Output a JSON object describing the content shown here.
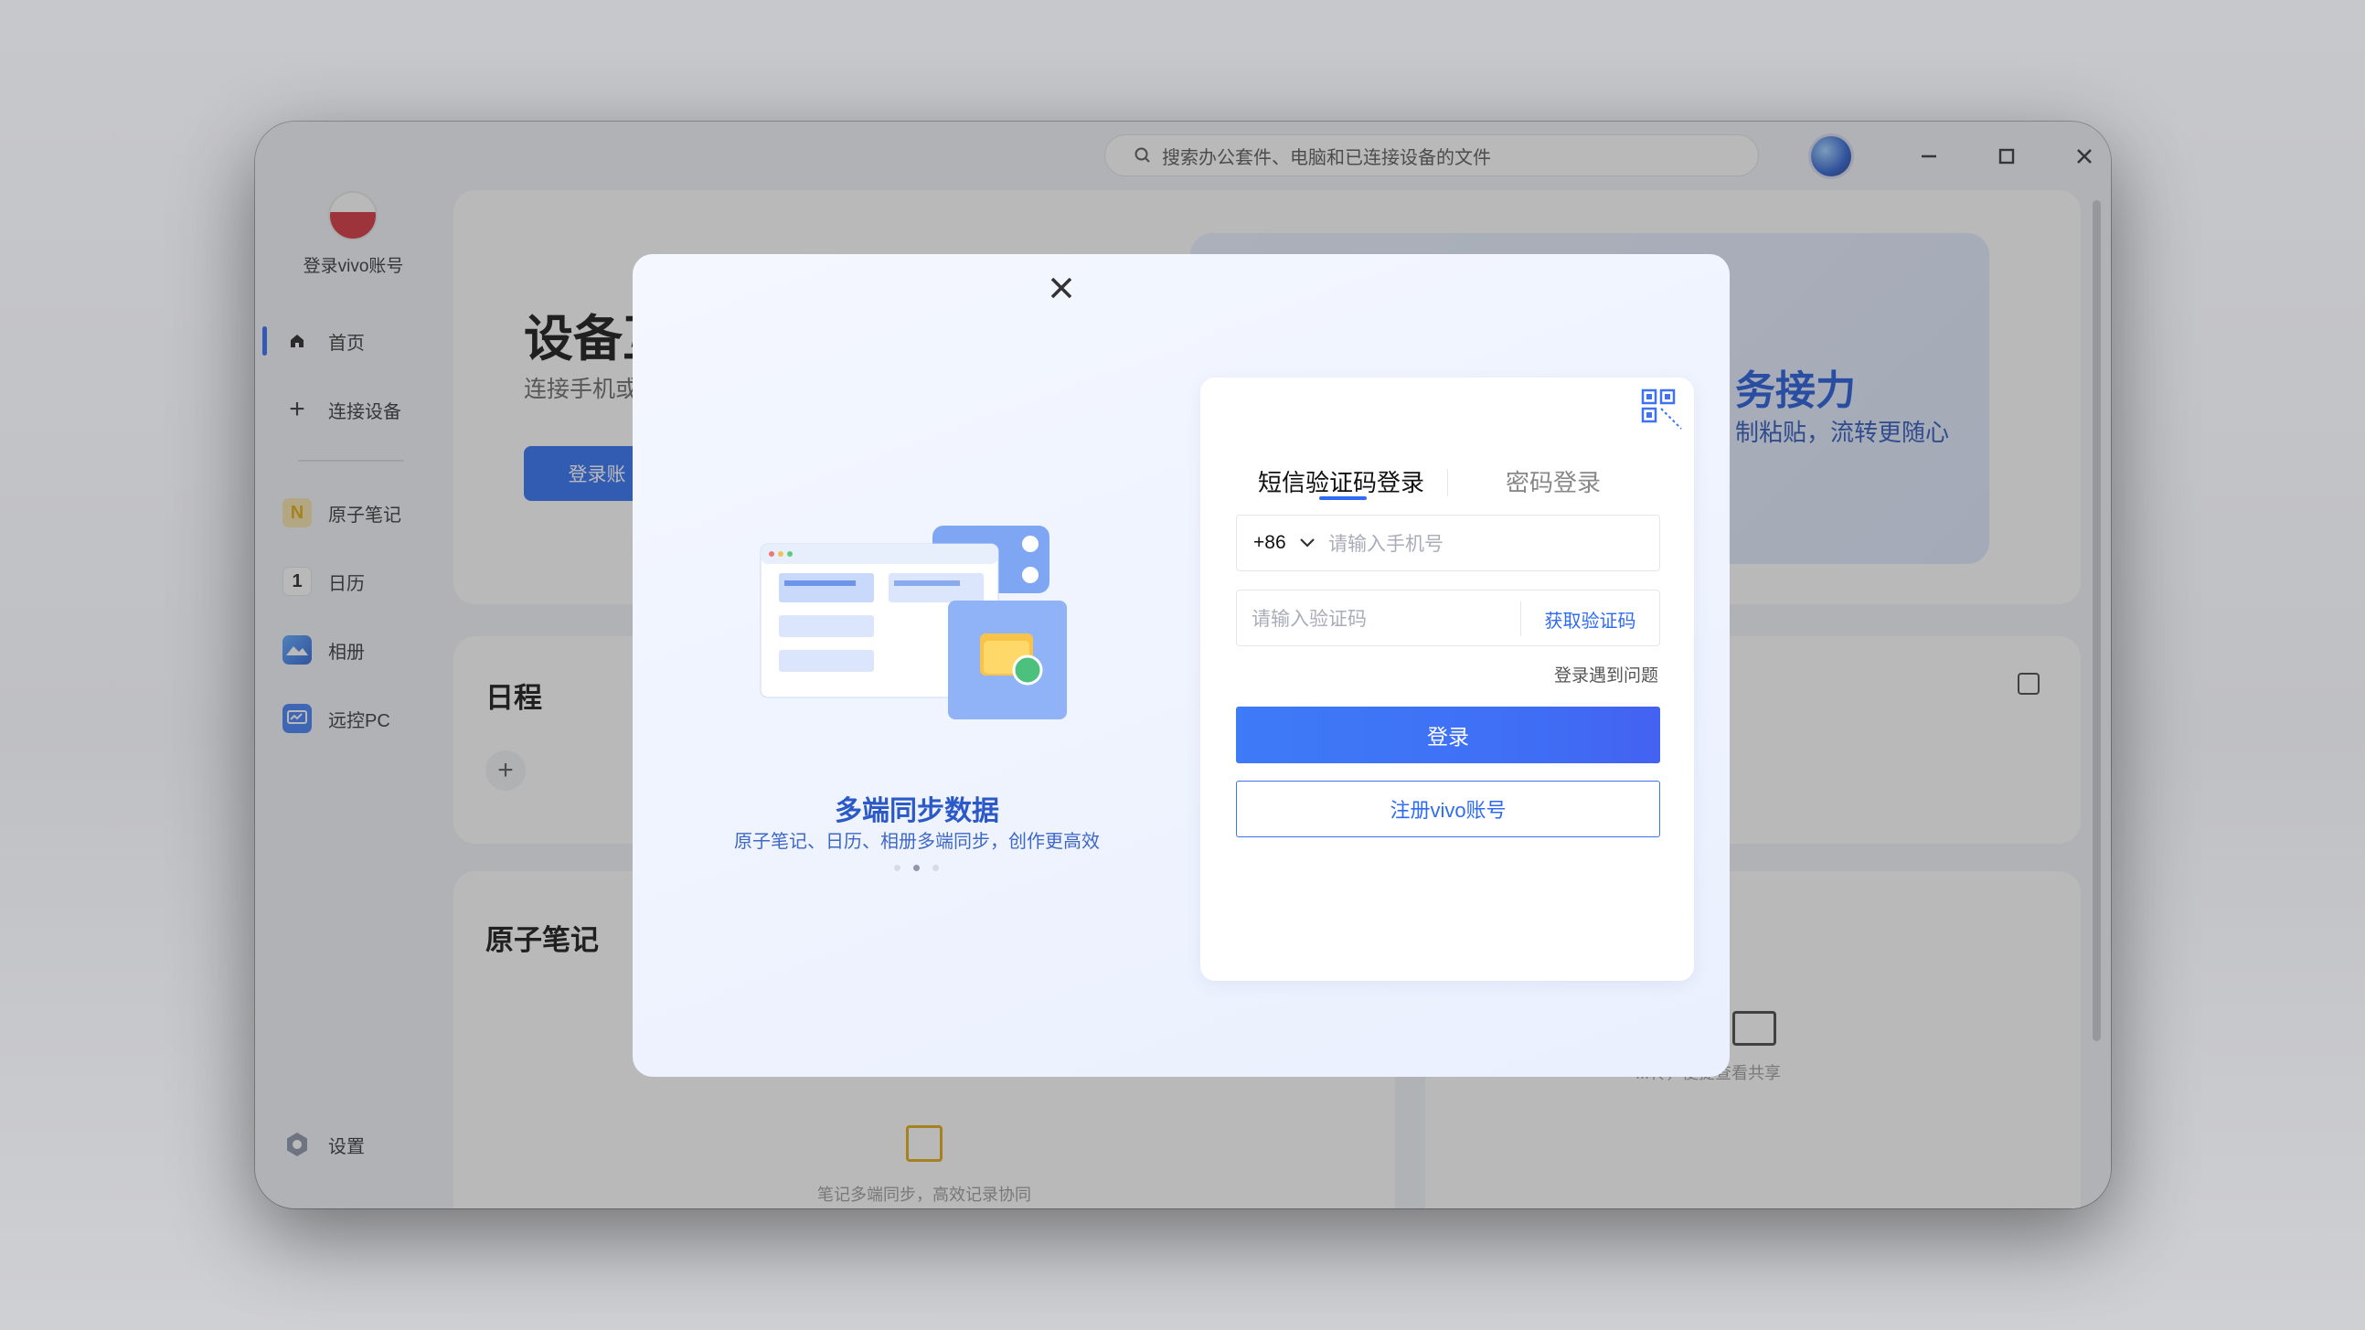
{
  "titlebar": {
    "search_placeholder": "搜索办公套件、电脑和已连接设备的文件",
    "search_icon": "search-icon",
    "minimize_icon": "minimize-icon",
    "maximize_icon": "maximize-icon",
    "close_icon": "close-icon"
  },
  "sidebar": {
    "login_text": "登录vivo账号",
    "items": [
      {
        "label": "首页",
        "icon": "home-icon"
      },
      {
        "label": "连接设备",
        "icon": "plus-icon"
      },
      {
        "label": "原子笔记",
        "icon": "notes-app-icon"
      },
      {
        "label": "日历",
        "icon": "calendar-app-icon"
      },
      {
        "label": "相册",
        "icon": "gallery-app-icon"
      },
      {
        "label": "远控PC",
        "icon": "remote-pc-icon"
      }
    ],
    "settings_label": "设置",
    "calendar_icon_number": "1"
  },
  "hero": {
    "title": "设备互",
    "subtitle": "连接手机或",
    "button": "登录账",
    "right_title": "务接力",
    "right_subtitle": "制粘贴，流转更随心"
  },
  "schedule": {
    "title": "日程"
  },
  "notes": {
    "title": "原子笔记",
    "empty_text": "笔记多端同步，高效记录协同"
  },
  "gallery": {
    "empty_text": "...转，便捷查看共享"
  },
  "modal": {
    "slogan": "多端同步数据",
    "slogan_sub": "原子笔记、日历、相册多端同步，创作更高效",
    "carousel_active_index": 1,
    "tabs": [
      {
        "label": "短信验证码登录",
        "active": true
      },
      {
        "label": "密码登录",
        "active": false
      }
    ],
    "country_code": "+86",
    "phone_placeholder": "请输入手机号",
    "code_placeholder": "请输入验证码",
    "get_code": "获取验证码",
    "trouble": "登录遇到问题",
    "login_button": "登录",
    "register_button": "注册vivo账号"
  },
  "colors": {
    "accent": "#2e6bf5",
    "slogan": "#2b59c8"
  }
}
